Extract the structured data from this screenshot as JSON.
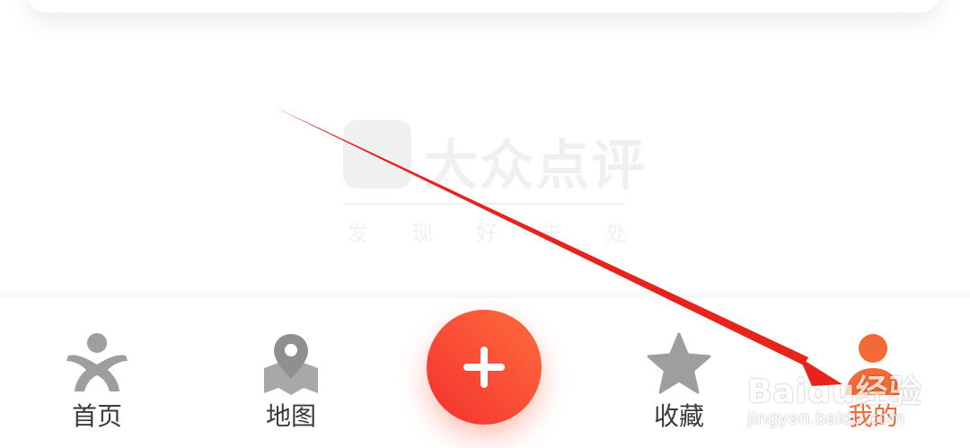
{
  "watermark": {
    "title": "大众点评",
    "slogan": "发现好去处"
  },
  "nav": {
    "items": [
      {
        "label": "首页",
        "icon": "dianping-person-icon"
      },
      {
        "label": "地图",
        "icon": "map-pin-icon"
      },
      {
        "label": "收藏",
        "icon": "star-icon"
      },
      {
        "label": "我的",
        "icon": "user-icon"
      }
    ],
    "plus_icon": "plus-icon",
    "active_index": 3
  },
  "baidu_watermark": {
    "brand": "Baidu经验",
    "url": "jingyan.baidu.com"
  },
  "colors": {
    "accent": "#f26a35",
    "plus_gradient_start": "#f4302f",
    "plus_gradient_end": "#ff6d3d",
    "icon_gray": "#9e9e9e",
    "label": "#3a3a3a",
    "arrow": "#e8231c"
  }
}
